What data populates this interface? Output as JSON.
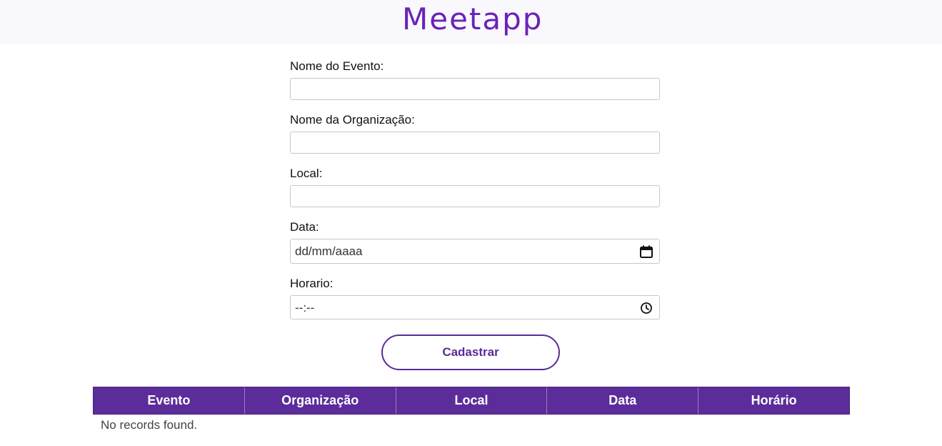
{
  "header": {
    "logo_text": "Meetapp",
    "brand_color": "#6a22b8"
  },
  "form": {
    "fields": [
      {
        "label": "Nome do Evento:",
        "value": ""
      },
      {
        "label": "Nome da Organização:",
        "value": ""
      },
      {
        "label": "Local:",
        "value": ""
      },
      {
        "label": "Data:",
        "value": "dd/mm/aaaa",
        "icon": "calendar-icon"
      },
      {
        "label": "Horario:",
        "value": "--:--",
        "icon": "clock-icon"
      }
    ],
    "submit_label": "Cadastrar"
  },
  "table": {
    "headers": [
      "Evento",
      "Organização",
      "Local",
      "Data",
      "Horário"
    ],
    "header_color": "#5c2d9a",
    "empty_message": "No records found."
  }
}
